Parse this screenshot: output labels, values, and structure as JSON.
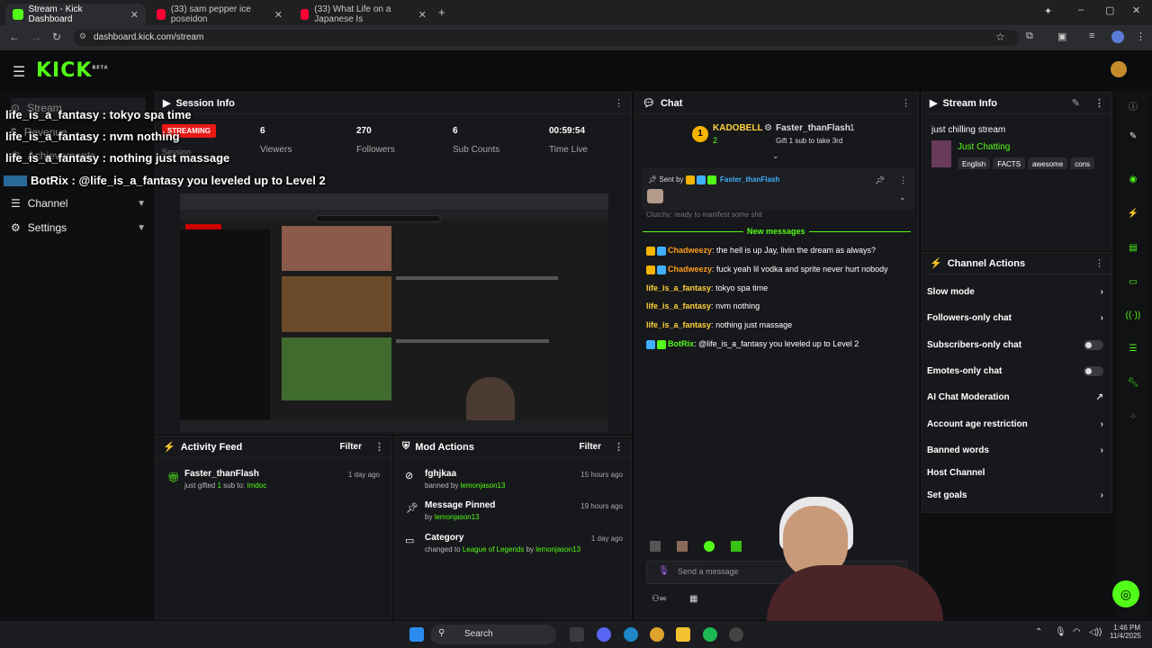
{
  "browser": {
    "tabs": [
      {
        "title": "Stream - Kick Dashboard",
        "active": true
      },
      {
        "title": "(33) sam pepper ice poseidon",
        "active": false
      },
      {
        "title": "(33) What Life on a Japanese Is",
        "active": false
      }
    ],
    "url": "dashboard.kick.com/stream"
  },
  "kick": {
    "logo": "KICK",
    "logo_beta": "BETA",
    "sidebar": {
      "items": [
        {
          "label": "Stream"
        },
        {
          "label": "Revenue"
        },
        {
          "label": "Achievements"
        },
        {
          "label": "Channel"
        },
        {
          "label": "Settings"
        }
      ]
    }
  },
  "overlay": {
    "lines": [
      "life_is_a_fantasy : tokyo spa time",
      "life_is_a_fantasy : nvm nothing",
      "life_is_a_fantasy : nothing just massage",
      "BotRix : @life_is_a_fantasy you leveled up to Level 2"
    ]
  },
  "session": {
    "title": "Session Info",
    "status": "STREAMING",
    "session_label": "Session",
    "stats": [
      {
        "value": "6",
        "label": "Viewers"
      },
      {
        "value": "270",
        "label": "Followers"
      },
      {
        "value": "6",
        "label": "Sub Counts"
      },
      {
        "value": "00:59:54",
        "label": "Time Live"
      }
    ]
  },
  "activity": {
    "title": "Activity Feed",
    "filter": "Filter",
    "items": [
      {
        "user": "Faster_thanFlash",
        "text": "just gifted",
        "count": "1",
        "text2": "sub to:",
        "target": "Imdoc",
        "time": "1 day ago"
      }
    ]
  },
  "mod": {
    "title": "Mod Actions",
    "filter": "Filter",
    "items": [
      {
        "title": "fghjkaa",
        "pre": "banned by",
        "by": "lemonjason13",
        "time": "15 hours ago"
      },
      {
        "title": "Message Pinned",
        "pre": "by",
        "by": "lemonjason13",
        "time": "19 hours ago"
      },
      {
        "title": "Category",
        "pre": "changed to",
        "cat": "League of Legends",
        "by_pre": "by",
        "by": "lemonjason13",
        "time": "1 day ago"
      }
    ]
  },
  "chat": {
    "title": "Chat",
    "leader1": "KADOBELL",
    "leader1_count": "2",
    "leader2": "Faster_thanFlash",
    "leader2_count": "1",
    "leader2_sub": "Gift 1 sub to take 3rd",
    "pinned_label": "Sent by",
    "pinned_user": "Faster_thanFlash",
    "partial": "Clutchy: ready to manifest some shit",
    "new_messages": "New messages",
    "messages": [
      {
        "user": "Chadweezy",
        "text": "the hell is up Jay, livin the dream as always?",
        "color": "#ff9f1c"
      },
      {
        "user": "Chadweezy",
        "text": "fuck yeah lil vodka and sprite never hurt nobody",
        "color": "#ff9f1c"
      },
      {
        "user": "life_is_a_fantasy",
        "text": "tokyo spa time",
        "color": "#ffd33b"
      },
      {
        "user": "life_is_a_fantasy",
        "text": "nvm nothing",
        "color": "#ffd33b"
      },
      {
        "user": "life_is_a_fantasy",
        "text": "nothing just massage",
        "color": "#ffd33b"
      },
      {
        "user": "BotRix",
        "text": "@life_is_a_fantasy you leveled up to Level 2",
        "color": "#53fc18"
      }
    ],
    "input_placeholder": "Send a message"
  },
  "stream_info": {
    "title": "Stream Info",
    "stream_title": "just chilling stream",
    "category": "Just Chatting",
    "tags": [
      "English",
      "FACTS",
      "awesome",
      "cons"
    ]
  },
  "channel_actions": {
    "title": "Channel Actions",
    "items": [
      {
        "label": "Slow mode",
        "control": "arrow"
      },
      {
        "label": "Followers-only chat",
        "control": "arrow"
      },
      {
        "label": "Subscribers-only chat",
        "control": "toggle"
      },
      {
        "label": "Emotes-only chat",
        "control": "toggle"
      },
      {
        "label": "AI Chat Moderation",
        "control": "external"
      },
      {
        "label": "Account age restriction",
        "control": "arrow"
      },
      {
        "label": "Banned words",
        "control": "arrow"
      },
      {
        "label": "Host Channel",
        "control": "none"
      },
      {
        "label": "Set goals",
        "control": "arrow"
      }
    ]
  },
  "taskbar": {
    "search": "Search",
    "time": "1:46 PM",
    "date": "11/4/2025"
  },
  "colors": {
    "accent": "#53fc18",
    "streaming": "#e91916"
  }
}
